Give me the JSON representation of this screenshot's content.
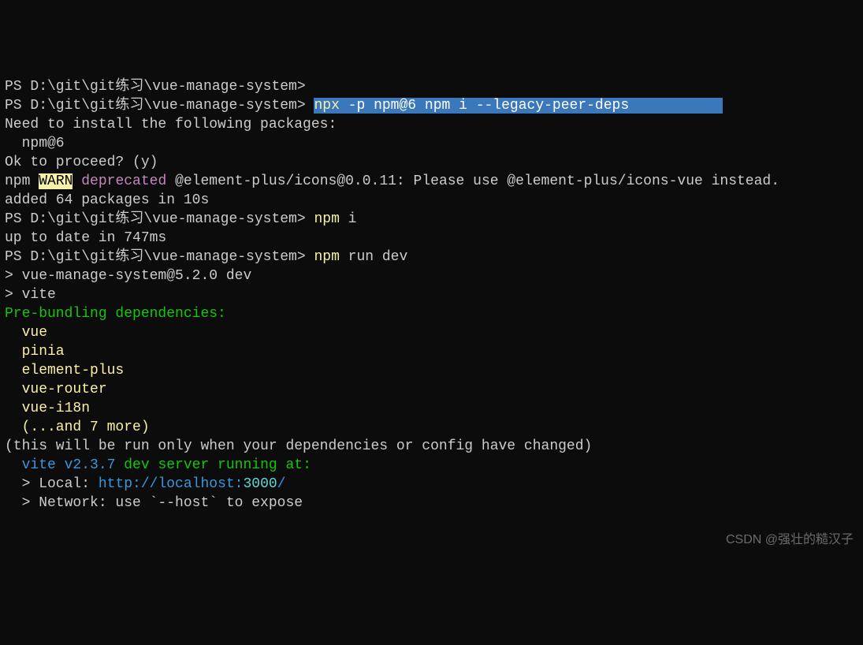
{
  "lines": {
    "l1": {
      "prompt": "PS D:\\git\\git练习\\vue-manage-system>"
    },
    "l2": {
      "prompt": "PS D:\\git\\git练习\\vue-manage-system> ",
      "cmd_npx": "npx",
      "cmd_rest": " -p npm@6 npm i --legacy-peer-deps           "
    },
    "l3": "Need to install the following packages:",
    "l4": "  npm@6",
    "l5": "Ok to proceed? (y)",
    "l6": {
      "npm": "npm ",
      "warn": "WARN",
      "space": " ",
      "deprecated": "deprecated",
      "rest": " @element-plus/icons@0.0.11: Please use @element-plus/icons-vue instead."
    },
    "l7": "",
    "l8": "added 64 packages in 10s",
    "l9": {
      "prompt": "PS D:\\git\\git练习\\vue-manage-system> ",
      "cmd": "npm",
      "rest": " i"
    },
    "l10": "",
    "l11": "up to date in 747ms",
    "l12": {
      "prompt": "PS D:\\git\\git练习\\vue-manage-system> ",
      "cmd": "npm",
      "rest": " run dev"
    },
    "l13": "",
    "l14": "> vue-manage-system@5.2.0 dev",
    "l15": "> vite",
    "l16": "",
    "l17": "Pre-bundling dependencies:",
    "l18": "  vue",
    "l19": "  pinia",
    "l20": "  element-plus",
    "l21": "  vue-router",
    "l22": "  vue-i18n",
    "l23": "  (...and 7 more)",
    "l24": "(this will be run only when your dependencies or config have changed)",
    "l25": "",
    "l26": {
      "vite": "  vite v2.3.7",
      "rest": " dev server running at:"
    },
    "l27": "",
    "l28": {
      "prefix": "  > Local:",
      "space": " ",
      "url1": "http://localhost:",
      "port": "3000",
      "slash": "/"
    },
    "l29": "  > Network: use `--host` to expose"
  },
  "watermark": "CSDN @强壮的糙汉子"
}
